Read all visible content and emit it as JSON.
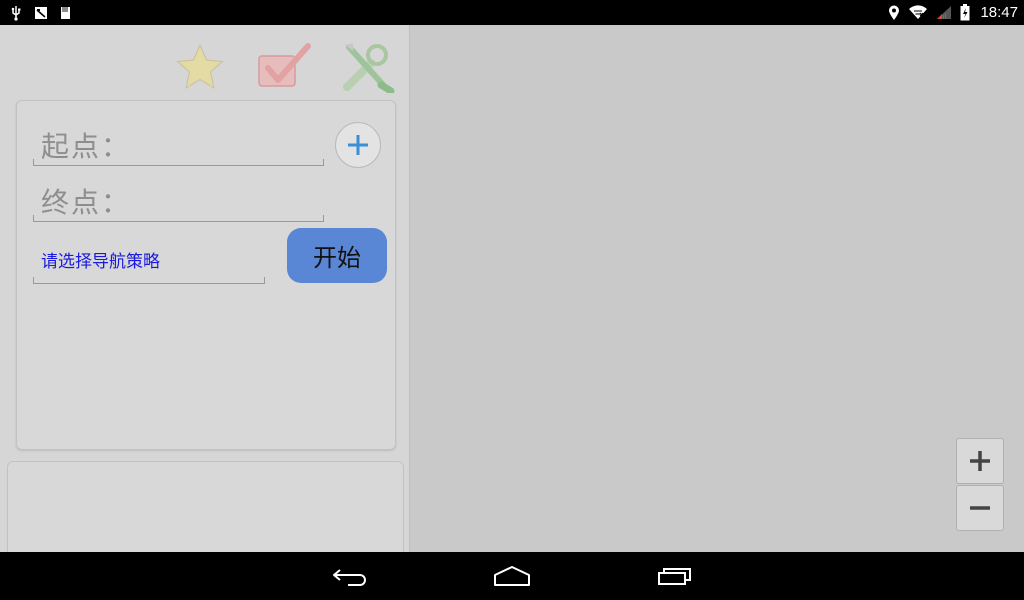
{
  "status_bar": {
    "time": "18:47",
    "left_icons": [
      "usb-icon",
      "screenshot-icon",
      "sd-card-icon"
    ],
    "right_icons": [
      "location-icon",
      "wifi-icon",
      "signal-icon",
      "battery-icon"
    ]
  },
  "toolbar": {
    "icons": [
      "star-icon",
      "check-icon",
      "tools-icon"
    ]
  },
  "route_form": {
    "start_label": "起点：",
    "end_label": "终点：",
    "strategy_placeholder": "请选择导航策略",
    "add_label": "+",
    "start_button_label": "开始"
  },
  "map": {
    "zoom_in_label": "+",
    "zoom_out_label": "−"
  },
  "nav_bar": {
    "buttons": [
      "back-icon",
      "home-icon",
      "recents-icon"
    ]
  },
  "colors": {
    "accent": "#5a86d6",
    "strategy_text": "#1a1adf",
    "plus_blue": "#3b8fd6",
    "map_bg": "#c9c9c9",
    "panel_bg": "#d6d6d6"
  }
}
